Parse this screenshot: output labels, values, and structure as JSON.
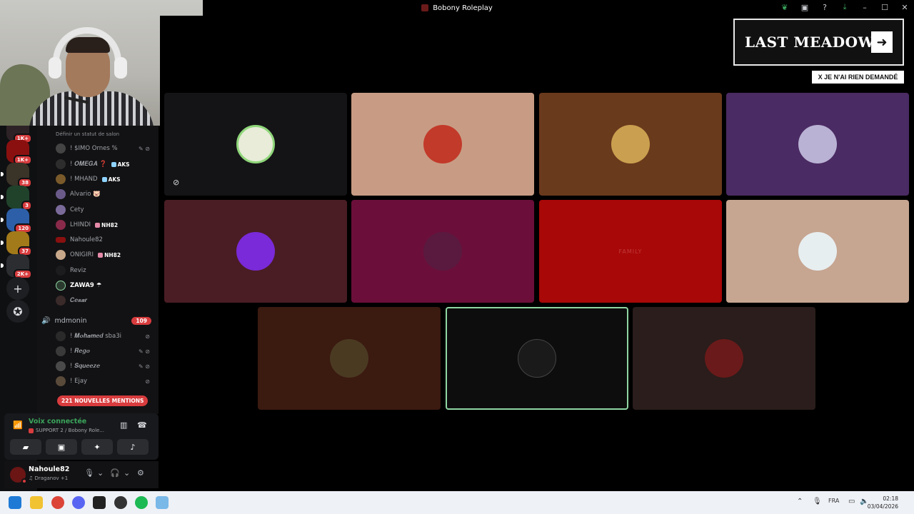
{
  "window": {
    "title": "Bobony Roleplay"
  },
  "rail": {
    "badges": [
      "1K+",
      "1K+",
      "38",
      "3",
      "120",
      "37",
      "2K+"
    ]
  },
  "sidebar": {
    "partial_channel": "SUPPORT 2",
    "status_hint": "Définir un statut de salon",
    "support_users": [
      {
        "name": "! $IMO Ornes %",
        "tag": ""
      },
      {
        "name": "! 𝑶𝑴𝑬𝑮𝑨 ❓",
        "tag": "AKS"
      },
      {
        "name": "! MHAND",
        "tag": "AKS"
      },
      {
        "name": "Alvario 🐷",
        "tag": ""
      },
      {
        "name": "Cety",
        "tag": ""
      },
      {
        "name": "LHINDI",
        "tag": "NH82"
      },
      {
        "name": "Nahoule82",
        "tag": ""
      },
      {
        "name": "ONIGIRI",
        "tag": "NH82"
      },
      {
        "name": "Reviz",
        "tag": ""
      },
      {
        "name": "ZAWA9 ☂",
        "tag": ""
      },
      {
        "name": "𝑪𝒆𝒔𝒂𝒓",
        "tag": ""
      }
    ],
    "channel": {
      "name": "mdmonin",
      "count": "109"
    },
    "channel_users": [
      {
        "name": "! 𝑴𝒐𝒉𝒂𝒎𝒆𝒅 sba3i"
      },
      {
        "name": "! 𝑹𝒆𝒈𝒐"
      },
      {
        "name": "! 𝑺𝒒𝒖𝒆𝒆𝒛𝒆"
      },
      {
        "name": "! Ejay"
      }
    ],
    "mentions": "221 NOUVELLES MENTIONS"
  },
  "voice_panel": {
    "status": "Voix connectée",
    "location": "SUPPORT 2 / Bobony Role..."
  },
  "user_panel": {
    "username": "Nahoule82",
    "activity": "♫ Draganov +1"
  },
  "stage": {
    "tile_colors": [
      "#141416",
      "#c89c84",
      "#6a3a1c",
      "#4b2b63",
      "#4a1d24",
      "#6b0f3a",
      "#a80808",
      "#c6a591",
      "#3b1a10",
      "#0d0d0d",
      "#2a1d1b"
    ],
    "tile_red_text": "FAMILY",
    "banner_title": "LAST MEADOW",
    "banner_subtitle": "X JE N'AI RIEN DEMANDÉ"
  },
  "taskbar": {
    "lang": "FRA",
    "time": "02:18",
    "date": "03/04/2026"
  }
}
